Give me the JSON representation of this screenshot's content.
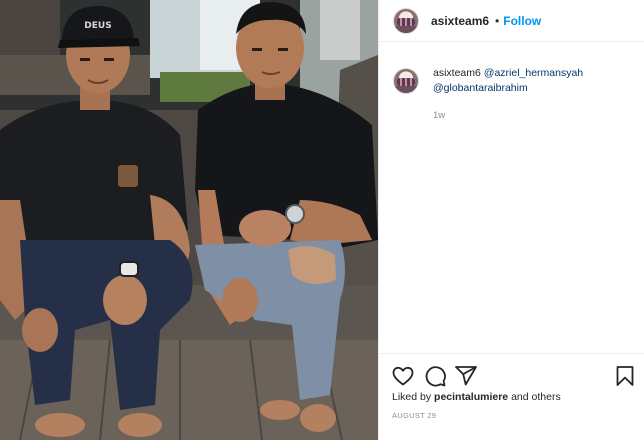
{
  "header": {
    "username": "asixteam6",
    "separator": "•",
    "follow_label": "Follow"
  },
  "caption": {
    "username": "asixteam6",
    "mention_1": "@azriel_hermansyah",
    "mention_2": "@globantaraibrahim",
    "age": "1w"
  },
  "photo": {
    "cap_text": "DEUS"
  },
  "actions": {
    "icons": [
      "heart-icon",
      "comment-icon",
      "share-icon",
      "bookmark-icon"
    ]
  },
  "likes": {
    "prefix": "Liked by",
    "user": "pecintalumiere",
    "suffix": "and others"
  },
  "date": "AUGUST 29",
  "colors": {
    "follow_blue": "#0095f6",
    "mention_blue": "#00376b",
    "muted_gray": "#8e8e8e",
    "border": "#efefef"
  }
}
